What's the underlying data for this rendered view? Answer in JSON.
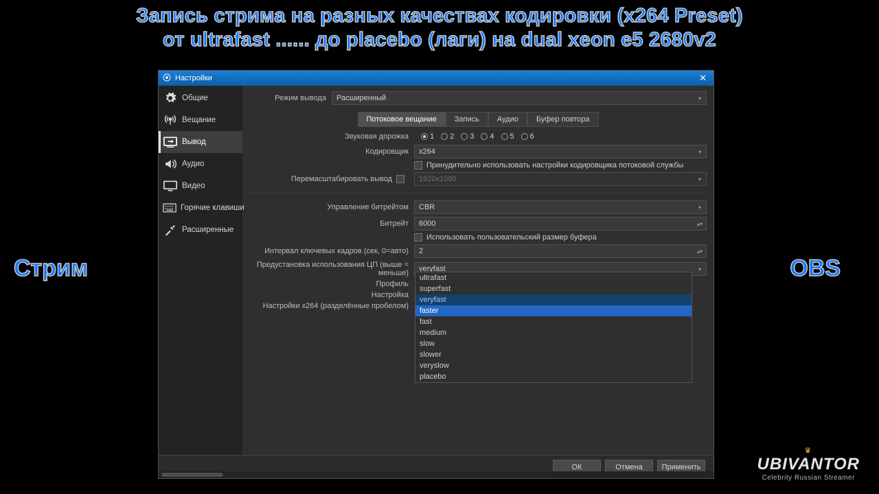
{
  "overlay": {
    "line1": "Запись стрима на разных качествах кодировки (x264 Preset)",
    "line2": "от ultrafast ...... до placebo (лаги) на dual xeon e5 2680v2",
    "left_label": "Стрим",
    "right_label": "OBS",
    "brand_name": "UBIVANTOR",
    "brand_sub": "Celebrity Russian Streamer"
  },
  "dialog": {
    "title": "Настройки",
    "sidebar": [
      {
        "icon": "gear",
        "label": "Общие"
      },
      {
        "icon": "antenna",
        "label": "Вещание"
      },
      {
        "icon": "output",
        "label": "Вывод"
      },
      {
        "icon": "speaker",
        "label": "Аудио"
      },
      {
        "icon": "monitor",
        "label": "Видео"
      },
      {
        "icon": "keyboard",
        "label": "Горячие клавиши"
      },
      {
        "icon": "tools",
        "label": "Расширенные"
      }
    ],
    "selected_sidebar_index": 2,
    "header": {
      "mode_label": "Режим вывода",
      "mode_value": "Расширенный"
    },
    "tabs": [
      "Потоковое вещание",
      "Запись",
      "Аудио",
      "Буфер повтора"
    ],
    "active_tab_index": 0,
    "audio_track": {
      "label": "Звуковая дорожка",
      "options": [
        "1",
        "2",
        "3",
        "4",
        "5",
        "6"
      ],
      "selected_index": 0
    },
    "encoder": {
      "label": "Кодировщик",
      "value": "x264"
    },
    "enforce": {
      "label": "Принудительно использовать настройки кодировщика потоковой службы",
      "checked": false
    },
    "rescale": {
      "label": "Перемасштабировать вывод",
      "checked": false,
      "value": "1920x1080"
    },
    "rate_control": {
      "label": "Управление битрейтом",
      "value": "CBR"
    },
    "bitrate": {
      "label": "Битрейт",
      "value": "6000"
    },
    "custom_buffer": {
      "label": "Использовать пользовательский размер буфера",
      "checked": false
    },
    "keyframe": {
      "label": "Интервал ключевых кадров (сек, 0=авто)",
      "value": "2"
    },
    "preset": {
      "label": "Предустановка использования ЦП (выше = меньше)",
      "value": "veryfast"
    },
    "profile": {
      "label": "Профиль"
    },
    "tune": {
      "label": "Настройка"
    },
    "x264opts": {
      "label": "Настройки x264 (разделённые пробелом)"
    },
    "dropdown_options": [
      "ultrafast",
      "superfast",
      "veryfast",
      "faster",
      "fast",
      "medium",
      "slow",
      "slower",
      "veryslow",
      "placebo"
    ],
    "dropdown_current_index": 2,
    "dropdown_highlight_index": 3,
    "footer": {
      "ok": "ОК",
      "cancel": "Отмена",
      "apply": "Применить"
    }
  }
}
